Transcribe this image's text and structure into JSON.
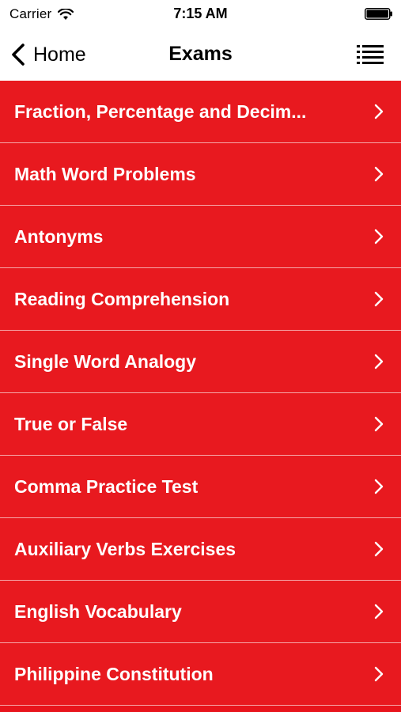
{
  "status_bar": {
    "carrier": "Carrier",
    "time": "7:15 AM",
    "wifi_icon": "wifi-icon",
    "battery_icon": "battery-icon"
  },
  "nav": {
    "back_label": "Home",
    "back_icon": "chevron-left-icon",
    "title": "Exams",
    "list_icon": "list-icon"
  },
  "exams": {
    "items": [
      {
        "label": "Fraction, Percentage and Decim..."
      },
      {
        "label": "Math Word Problems"
      },
      {
        "label": "Antonyms"
      },
      {
        "label": "Reading Comprehension"
      },
      {
        "label": "Single Word Analogy"
      },
      {
        "label": "True or False"
      },
      {
        "label": "Comma Practice Test"
      },
      {
        "label": "Auxiliary Verbs Exercises"
      },
      {
        "label": "English Vocabulary"
      },
      {
        "label": "Philippine Constitution"
      }
    ],
    "row_icon": "chevron-right-icon"
  },
  "colors": {
    "row_background": "#e8191f",
    "row_separator": "#f6a8aa",
    "row_text": "#ffffff",
    "nav_background": "#ffffff"
  }
}
